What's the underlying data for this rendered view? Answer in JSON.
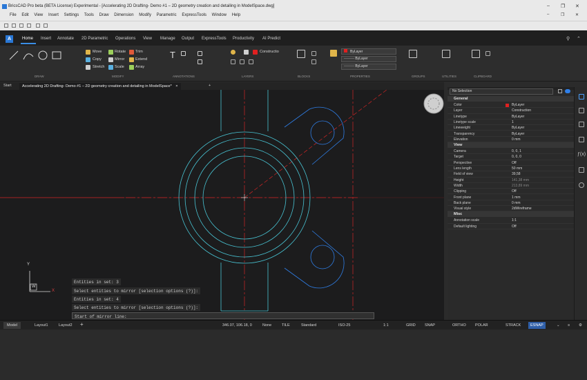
{
  "window": {
    "title": "BricsCAD Pro beta (BETA License) Experimental - [Accelerating 2D Drafting- Demo #1 – 2D geometry creation and detailing in ModelSpace.dwg]",
    "menu": [
      "File",
      "Edit",
      "View",
      "Insert",
      "Settings",
      "Tools",
      "Draw",
      "Dimension",
      "Modify",
      "Parametric",
      "ExpressTools",
      "Window",
      "Help"
    ]
  },
  "ribbon": {
    "app_button": "A",
    "tabs": [
      "Home",
      "Insert",
      "Annotate",
      "2D Parametric",
      "Operations",
      "View",
      "Manage",
      "Output",
      "ExpressTools",
      "Productivity",
      "AI Predict"
    ],
    "active_tab": "Home",
    "groups": [
      "DRAW",
      "MODIFY",
      "ANNOTATIONS",
      "LAYERS",
      "BLOCKS",
      "PROPERTIES",
      "GROUPS",
      "UTILITIES",
      "CLIPBOARD"
    ],
    "modify": [
      "Move",
      "Rotate",
      "Trim",
      "Copy",
      "Mirror",
      "Extend",
      "Stretch",
      "Scale",
      "Array"
    ],
    "layer_value": "Constructio",
    "props": [
      "ByLayer",
      "ByLayer",
      "ByLayer"
    ],
    "colors": {
      "accent": "#3a8ee6",
      "red": "#e02020",
      "cyan": "#49c6d6",
      "blue": "#2f7fe8"
    }
  },
  "doc_tabs": {
    "start": "Start",
    "active": "Accelerating 2D Drafting- Demo #1 – 2D geometry creation and detailing in ModelSpace*",
    "add": "+"
  },
  "command": {
    "lines": [
      "Entities in set: 3",
      "Select entities to mirror [selection options (?)]:",
      "Entities in set: 4",
      "Select entities to mirror [selection options (?)]:",
      "Start of mirror line:"
    ]
  },
  "ucs": {
    "x": "X",
    "y": "Y",
    "w": "W"
  },
  "properties": {
    "selection": "No Selection",
    "sections": [
      {
        "name": "General",
        "rows": [
          [
            "Color",
            "ByLayer"
          ],
          [
            "Layer",
            "Construction"
          ],
          [
            "Linetype",
            "ByLayer"
          ],
          [
            "Linetype scale",
            "1"
          ],
          [
            "Lineweight",
            "ByLayer"
          ],
          [
            "Transparency",
            "ByLayer"
          ],
          [
            "Elevation",
            "0 mm"
          ]
        ]
      },
      {
        "name": "View",
        "rows": [
          [
            "Camera",
            "0, 0, 1"
          ],
          [
            "Target",
            "0, 0, 0"
          ],
          [
            "Perspective",
            "Off"
          ],
          [
            "Lens length",
            "50 mm"
          ],
          [
            "Field of view",
            "39,58"
          ],
          [
            "Height",
            "141,38 mm"
          ],
          [
            "Width",
            "213,89 mm"
          ],
          [
            "Clipping",
            "Off"
          ],
          [
            "Front plane",
            "1 mm"
          ],
          [
            "Back plane",
            "0 mm"
          ],
          [
            "Visual style",
            "2dWireframe"
          ]
        ]
      },
      {
        "name": "Misc",
        "rows": [
          [
            "Annotation scale",
            "1:1"
          ],
          [
            "Default lighting",
            "Off"
          ]
        ]
      }
    ]
  },
  "status": {
    "tabs": [
      "Model",
      "Layout1",
      "Layout2"
    ],
    "coords": "346.07, 106.18, 0",
    "items": [
      "None",
      "TILE",
      "Standard",
      "ISO-25",
      "1:1",
      "GRID",
      "SNAP",
      "ORTHO",
      "POLAR",
      "STRACK",
      "ESNAP"
    ]
  }
}
